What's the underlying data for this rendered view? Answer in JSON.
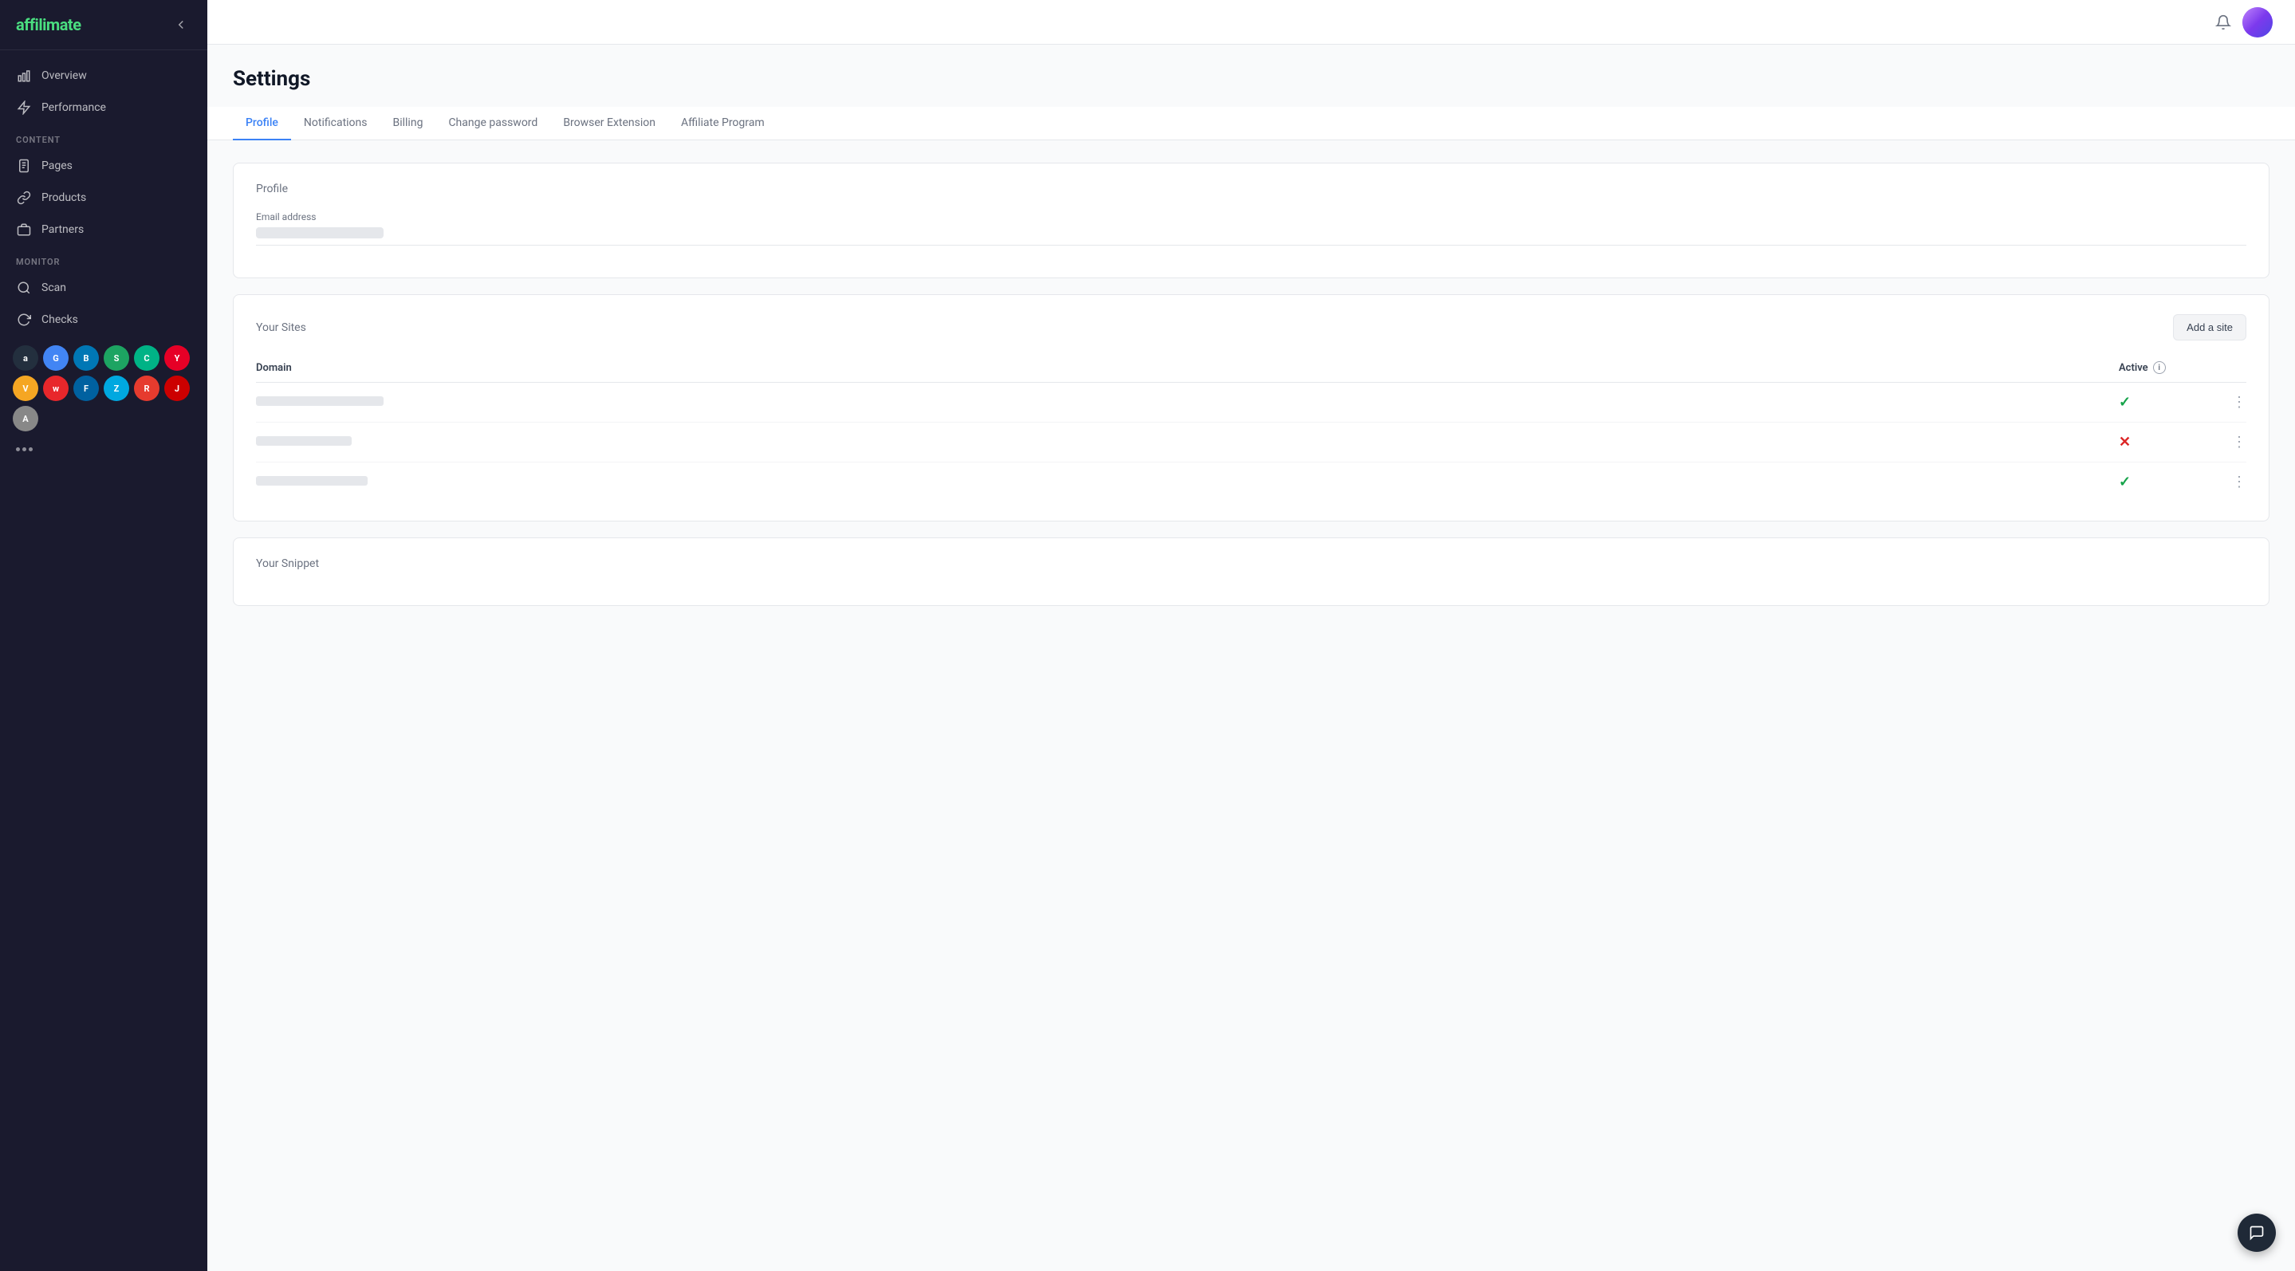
{
  "app": {
    "name": "affili",
    "name_accent": "mate"
  },
  "sidebar": {
    "nav_items": [
      {
        "id": "overview",
        "label": "Overview",
        "icon": "chart-bar"
      },
      {
        "id": "performance",
        "label": "Performance",
        "icon": "lightning"
      }
    ],
    "sections": [
      {
        "label": "CONTENT",
        "items": [
          {
            "id": "pages",
            "label": "Pages",
            "icon": "document"
          },
          {
            "id": "products",
            "label": "Products",
            "icon": "link"
          },
          {
            "id": "partners",
            "label": "Partners",
            "icon": "briefcase"
          }
        ]
      },
      {
        "label": "MONITOR",
        "items": [
          {
            "id": "scan",
            "label": "Scan",
            "icon": "search"
          },
          {
            "id": "checks",
            "label": "Checks",
            "icon": "refresh"
          }
        ]
      }
    ],
    "partners": [
      {
        "letter": "a",
        "color": "#ff9900",
        "bg": "#232f3e"
      },
      {
        "letter": "G",
        "color": "#fff",
        "bg": "#4285f4"
      },
      {
        "letter": "B",
        "color": "#fff",
        "bg": "#0077b5"
      },
      {
        "letter": "S",
        "color": "#fff",
        "bg": "#1da462"
      },
      {
        "letter": "C",
        "color": "#fff",
        "bg": "#00b386"
      },
      {
        "letter": "Y",
        "color": "#fff",
        "bg": "#e60026"
      },
      {
        "letter": "V",
        "color": "#fff",
        "bg": "#f5a623"
      },
      {
        "letter": "w",
        "color": "#fff",
        "bg": "#e8272b"
      },
      {
        "letter": "F",
        "color": "#fff",
        "bg": "#0061a0"
      },
      {
        "letter": "Z",
        "color": "#fff",
        "bg": "#00a8e0"
      },
      {
        "letter": "R",
        "color": "#fff",
        "bg": "#e63b2e"
      },
      {
        "letter": "J",
        "color": "#fff",
        "bg": "#cc0000"
      },
      {
        "letter": "A",
        "color": "#fff",
        "bg": "#888"
      }
    ]
  },
  "topbar": {
    "bell_icon": "bell",
    "avatar_icon": "user-avatar"
  },
  "page": {
    "title": "Settings",
    "tabs": [
      {
        "id": "profile",
        "label": "Profile",
        "active": true
      },
      {
        "id": "notifications",
        "label": "Notifications",
        "active": false
      },
      {
        "id": "billing",
        "label": "Billing",
        "active": false
      },
      {
        "id": "change-password",
        "label": "Change password",
        "active": false
      },
      {
        "id": "browser-extension",
        "label": "Browser Extension",
        "active": false
      },
      {
        "id": "affiliate-program",
        "label": "Affiliate Program",
        "active": false
      }
    ]
  },
  "profile_section": {
    "title": "Profile",
    "email_label": "Email address",
    "email_value": ""
  },
  "sites_section": {
    "title": "Your Sites",
    "add_button": "Add a site",
    "table": {
      "domain_col": "Domain",
      "active_col": "Active",
      "rows": [
        {
          "domain_width": 160,
          "active": true
        },
        {
          "domain_width": 120,
          "active": false
        },
        {
          "domain_width": 140,
          "active": true
        }
      ]
    }
  },
  "snippet_section": {
    "title": "Your Snippet"
  }
}
